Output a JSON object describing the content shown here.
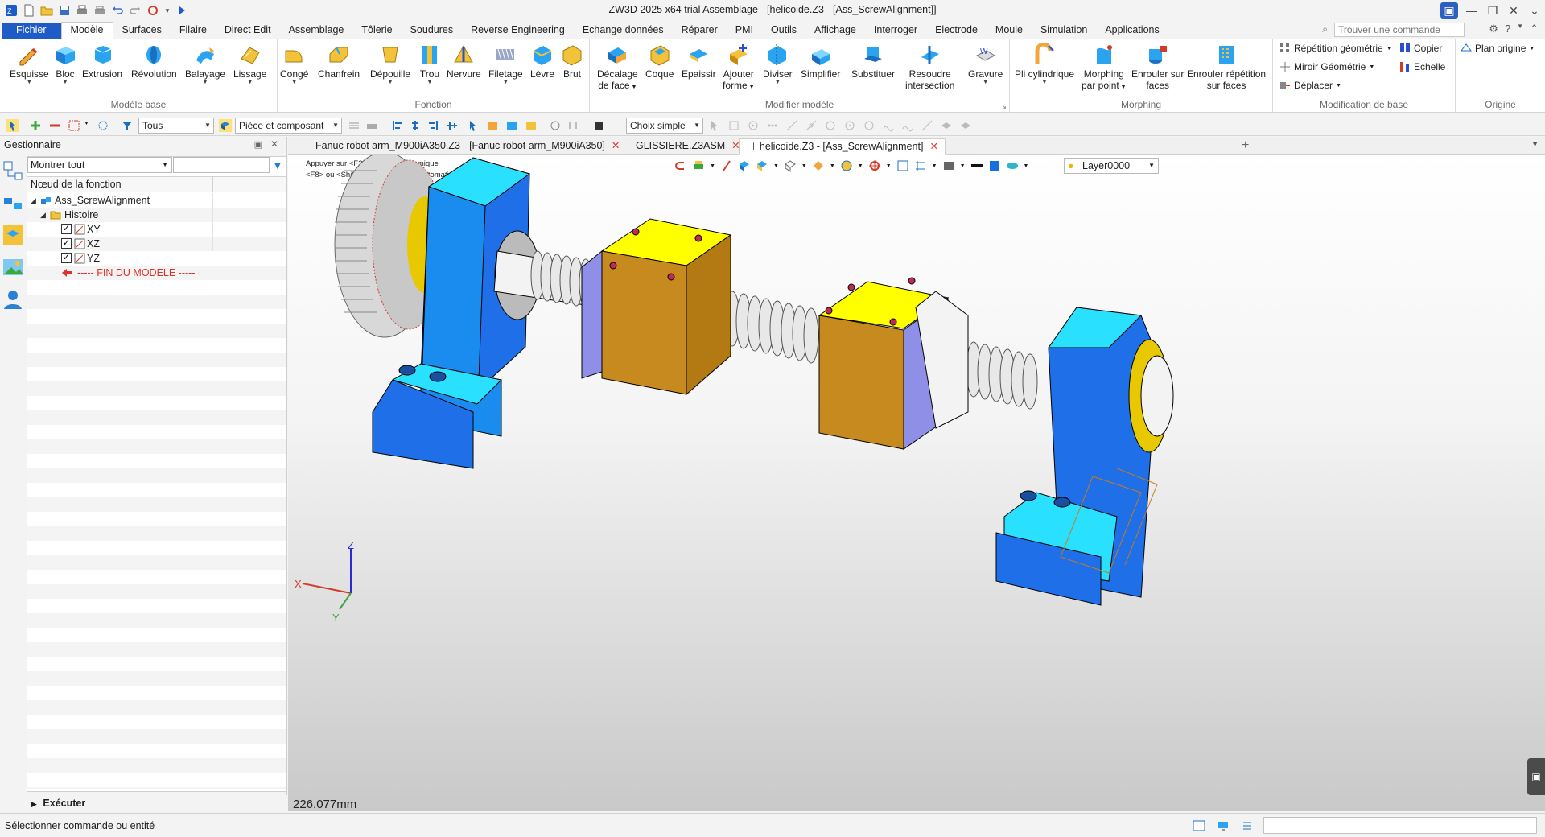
{
  "titlebar": {
    "title": "ZW3D 2025 x64 trial          Assemblage - [helicoide.Z3 - [Ass_ScrewAlignment]]"
  },
  "menu": {
    "file": "Fichier",
    "tabs": [
      "Modèle",
      "Surfaces",
      "Filaire",
      "Direct Edit",
      "Assemblage",
      "Tôlerie",
      "Soudures",
      "Reverse Engineering",
      "Echange données",
      "Réparer",
      "PMI",
      "Outils",
      "Affichage",
      "Interroger",
      "Electrode",
      "Moule",
      "Simulation",
      "Applications"
    ],
    "search_placeholder": "Trouver une commande"
  },
  "ribbon": {
    "groups": {
      "modele_base": "Modèle base",
      "fonction": "Fonction",
      "modifier": "Modifier modèle",
      "morphing": "Morphing",
      "modif_base": "Modification de base",
      "origine": "Origine"
    },
    "buttons": {
      "esquisse": "Esquisse",
      "bloc": "Bloc",
      "extrusion": "Extrusion",
      "revolution": "Révolution",
      "balayage": "Balayage",
      "lissage": "Lissage",
      "conge": "Congé",
      "chanfrein": "Chanfrein",
      "depouille": "Dépouille",
      "trou": "Trou",
      "nervure": "Nervure",
      "filetage": "Filetage",
      "levre": "Lèvre",
      "brut": "Brut",
      "decalage1": "Décalage",
      "decalage2": "de face",
      "coque": "Coque",
      "epaissir": "Epaissir",
      "ajouter1": "Ajouter",
      "ajouter2": "forme",
      "diviser": "Diviser",
      "simplifier": "Simplifier",
      "substituer": "Substituer",
      "resoudre1": "Resoudre",
      "resoudre2": "intersection",
      "gravure": "Gravure",
      "pli": "Pli cylindrique",
      "morphpt1": "Morphing",
      "morphpt2": "par point",
      "enrouler1": "Enrouler sur",
      "enrouler2": "faces",
      "enrouler_rep1": "Enrouler répétition",
      "enrouler_rep2": "sur faces",
      "repetition": "Répétition géométrie",
      "miroir": "Miroir Géométrie",
      "deplacer": "Déplacer",
      "copier": "Copier",
      "echelle": "Echelle",
      "plan_origine": "Plan origine"
    }
  },
  "filterbar": {
    "filter_all": "Tous",
    "piece": "Pièce et composant",
    "choix": "Choix simple"
  },
  "manager": {
    "title": "Gestionnaire",
    "filter": "Montrer tout",
    "column": "Nœud de la fonction",
    "tree": {
      "root": "Ass_ScrewAlignment",
      "histoire": "Histoire",
      "xy": "XY",
      "xz": "XZ",
      "yz": "YZ",
      "end": "----- FIN DU MODELE -----"
    },
    "execute": "Exécuter"
  },
  "doc_tabs": [
    "Fanuc robot arm_M900iA350.Z3 - [Fanuc robot arm_M900iA350]",
    "GLISSIERE.Z3ASM",
    "helicoide.Z3 - [Ass_ScrewAlignment]"
  ],
  "viewport": {
    "hint1": "Appuyer sur <F2> pour vue dynamique",
    "hint2": "<F8> ou <Shift + molette> Filtres automatique",
    "layer": "Layer0000",
    "measure": "226.077mm",
    "axes": {
      "x": "X",
      "y": "Y",
      "z": "Z"
    }
  },
  "status": {
    "text": "Sélectionner commande ou entité"
  },
  "colors": {
    "accent": "#1f5bc6",
    "part_blue": "#1e9bf0",
    "part_cyan": "#29e0ff",
    "nut_orange": "#c78a1e",
    "nut_yellow": "#ffff00",
    "end_red": "#e0322c"
  }
}
